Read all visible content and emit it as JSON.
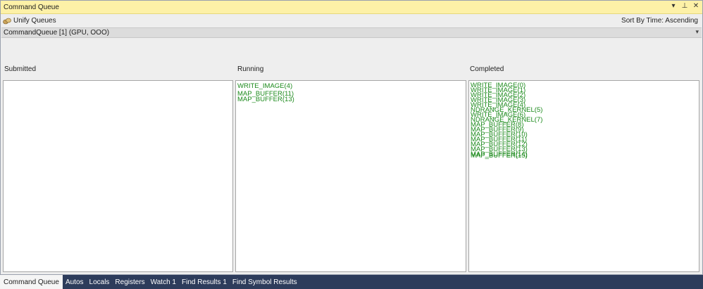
{
  "window": {
    "title": "Command Queue",
    "controls": {
      "dropdown": "▾",
      "pin": "⊥",
      "close": "✕"
    }
  },
  "toolbar": {
    "unify_label": "Unify Queues",
    "sort_label": "Sort By Time: Ascending"
  },
  "queue_selector": {
    "value": "CommandQueue [1] (GPU, OOO)"
  },
  "columns": {
    "submitted": {
      "label": "Submitted",
      "items": []
    },
    "running": {
      "label": "Running",
      "items": [
        "WRITE_IMAGE(4)",
        "MAP_BUFFER(11)",
        "MAP_BUFFER(13)"
      ]
    },
    "completed": {
      "label": "Completed",
      "items": [
        "WRITE_IMAGE(0)",
        "WRITE_IMAGE(1)",
        "WRITE_IMAGE(2)",
        "WRITE_IMAGE(3)",
        "WRITE_IMAGE(4)",
        "NDRANGE_KERNEL(5)",
        "WRITE_IMAGE(6)",
        "NDRANGE_KERNEL(7)",
        "MAP_BUFFER(8)",
        "MAP_BUFFER(9)",
        "MAP_BUFFER(10)",
        "MAP_BUFFER(11)",
        "MAP_BUFFER(12)",
        "MAP_BUFFER(13)",
        "MAP_BUFFER(14)",
        "MAP_BUFFER(15)"
      ]
    }
  },
  "tabs": [
    {
      "label": "Command Queue",
      "active": true
    },
    {
      "label": "Autos",
      "active": false
    },
    {
      "label": "Locals",
      "active": false
    },
    {
      "label": "Registers",
      "active": false
    },
    {
      "label": "Watch 1",
      "active": false
    },
    {
      "label": "Find Results 1",
      "active": false
    },
    {
      "label": "Find Symbol Results",
      "active": false
    }
  ],
  "colors": {
    "title_bar": "#fdf1a7",
    "item_text": "#1c8a1c",
    "tab_bar": "#2d3c5b"
  }
}
